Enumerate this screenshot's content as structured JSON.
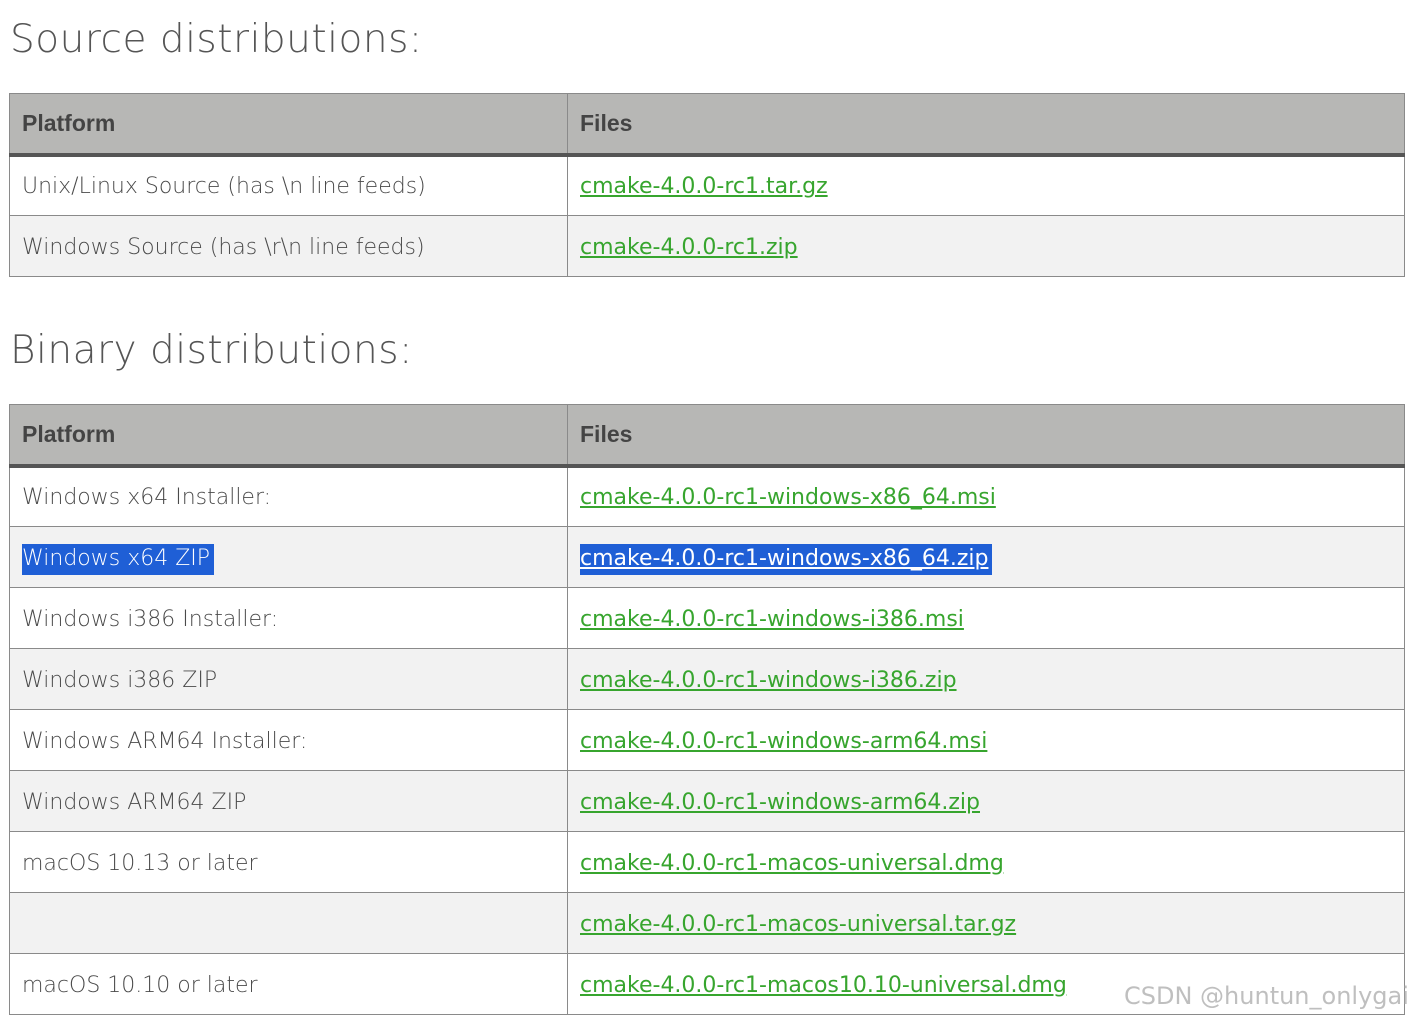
{
  "source_section": {
    "title": "Source distributions:",
    "headers": {
      "platform": "Platform",
      "files": "Files"
    },
    "rows": [
      {
        "platform": "Unix/Linux Source (has \\n line feeds)",
        "file": "cmake-4.0.0-rc1.tar.gz"
      },
      {
        "platform": "Windows Source (has \\r\\n line feeds)",
        "file": "cmake-4.0.0-rc1.zip"
      }
    ]
  },
  "binary_section": {
    "title": "Binary distributions:",
    "headers": {
      "platform": "Platform",
      "files": "Files"
    },
    "rows": [
      {
        "platform": "Windows x64 Installer:",
        "file": "cmake-4.0.0-rc1-windows-x86_64.msi"
      },
      {
        "platform": "Windows x64 ZIP",
        "file": "cmake-4.0.0-rc1-windows-x86_64.zip",
        "selected": true
      },
      {
        "platform": "Windows i386 Installer:",
        "file": "cmake-4.0.0-rc1-windows-i386.msi"
      },
      {
        "platform": "Windows i386 ZIP",
        "file": "cmake-4.0.0-rc1-windows-i386.zip"
      },
      {
        "platform": "Windows ARM64 Installer:",
        "file": "cmake-4.0.0-rc1-windows-arm64.msi"
      },
      {
        "platform": "Windows ARM64 ZIP",
        "file": "cmake-4.0.0-rc1-windows-arm64.zip"
      },
      {
        "platform": "macOS 10.13 or later",
        "file": "cmake-4.0.0-rc1-macos-universal.dmg"
      },
      {
        "platform": "",
        "file": "cmake-4.0.0-rc1-macos-universal.tar.gz"
      },
      {
        "platform": "macOS 10.10 or later",
        "file": "cmake-4.0.0-rc1-macos10.10-universal.dmg"
      }
    ]
  },
  "watermark": "CSDN @huntun_onlygai",
  "colors": {
    "link": "#37a52e",
    "header_bg": "#b7b7b5",
    "selection": "#1f5fd6",
    "row_alt": "#f2f2f2"
  }
}
